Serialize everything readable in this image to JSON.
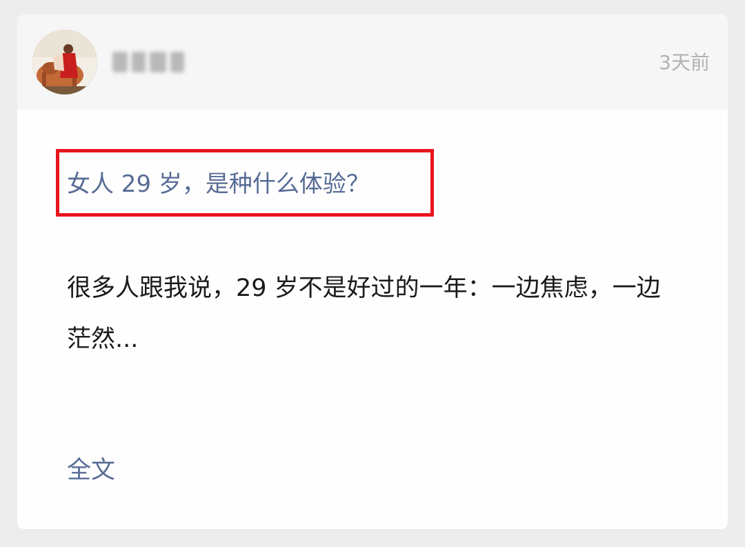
{
  "post": {
    "author": {
      "avatar_icon": "painting-avatar-icon",
      "name_blurred": true
    },
    "timestamp": "3天前",
    "title": "女人 29 岁，是种什么体验？",
    "excerpt": "很多人跟我说，29 岁不是好过的一年：一边焦虑，一边茫然...",
    "full_text_link": "全文"
  },
  "colors": {
    "page_bg": "#ededed",
    "card_bg": "#fefefe",
    "header_bg": "#f6f6f6",
    "link": "#576b95",
    "highlight_border": "#e8141e",
    "timestamp": "#b2b2b2"
  }
}
